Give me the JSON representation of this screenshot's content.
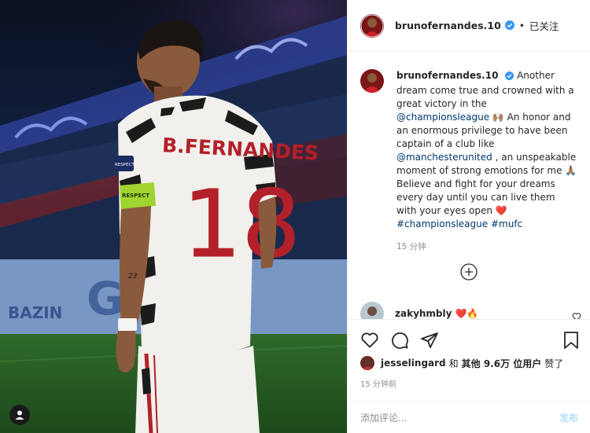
{
  "photo": {
    "jersey_name": "B.FERNANDES",
    "jersey_number": "18",
    "armband_text": "RESPECT",
    "sleeve_patch": "RESPECT",
    "arm_tattoo": "23",
    "tag_icon": "user-tag-icon"
  },
  "header": {
    "username": "brunofernandes.10",
    "dot": "•",
    "follow_state": "已关注"
  },
  "caption": {
    "username": "brunofernandes.10",
    "text_1": "Another dream come true and crowned with a great victory in the ",
    "mention_1": "@championsleague",
    "text_2": " 🙌🏽 An honor and an enormous privilege to have been captain of a club like ",
    "mention_2": "@manchesterunited",
    "text_3": " , an unspeakable moment of strong emotions for me 🙏🏽",
    "text_4": "Believe and fight for your dreams every day until you can live them with your eyes open ❤️",
    "hashtag_1": "#championsleague",
    "hashtag_2": "#mufc",
    "time": "15 分钟"
  },
  "comment": {
    "username": "zakyhmbly",
    "emojis": "❤️🔥"
  },
  "likes": {
    "user": "jesselingard",
    "joiner": "和",
    "others": "其他 9.6万 位用户",
    "suffix": "赞了"
  },
  "time_ago": "15 分钟前",
  "add_comment": {
    "placeholder": "添加评论...",
    "post_label": "发布"
  },
  "colors": {
    "link": "#00376b",
    "muted": "#8e8e8e",
    "verified": "#3897f0",
    "post_disabled": "#b2dffc",
    "heart": "#ed4956"
  }
}
